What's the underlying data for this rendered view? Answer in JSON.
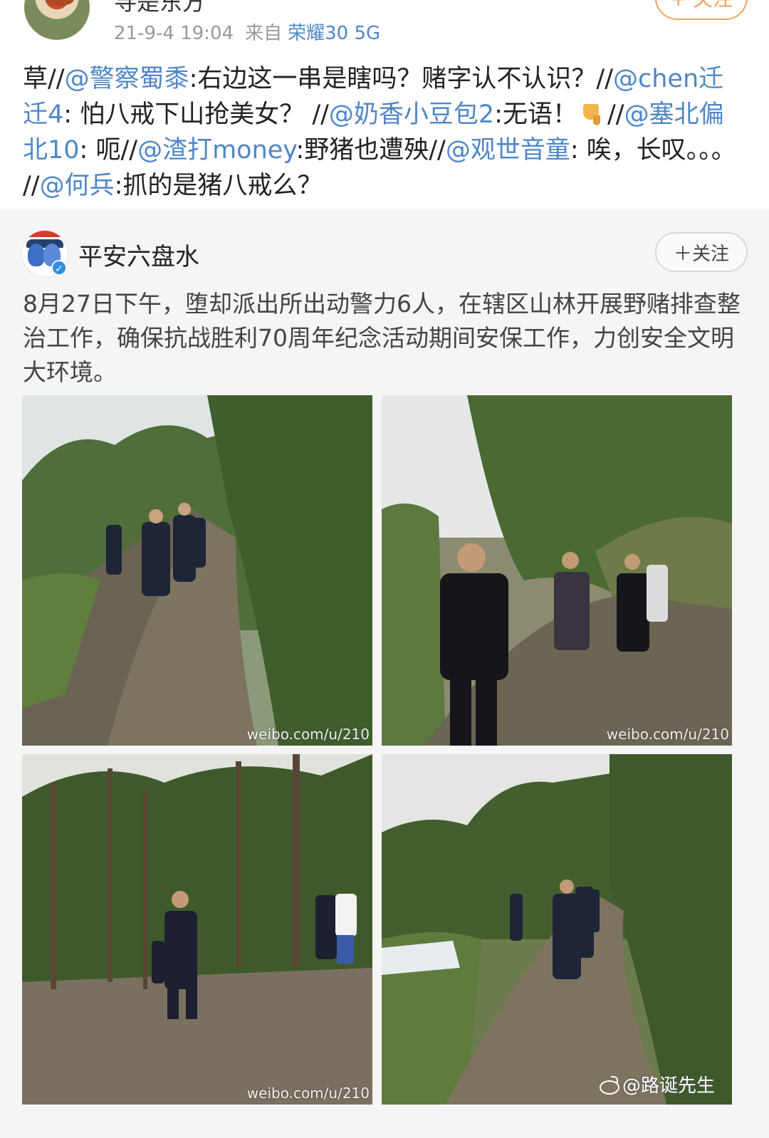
{
  "repost": {
    "username": "寻是东方",
    "time": "21-9-4 19:04",
    "source_prefix": "来自",
    "device": "荣耀30 5G",
    "follow_label": "+ 关注",
    "comment": [
      {
        "t": "text",
        "v": "草//"
      },
      {
        "t": "mention",
        "v": "@警察蜀黍"
      },
      {
        "t": "text",
        "v": ":右边这一串是瞎吗？赌字认不认识？//"
      },
      {
        "t": "mention",
        "v": "@chen迁迁4"
      },
      {
        "t": "text",
        "v": ": 怕八戒下山抢美女？ //"
      },
      {
        "t": "mention",
        "v": "@奶香小豆包2"
      },
      {
        "t": "text",
        "v": ":无语！"
      },
      {
        "t": "emoji",
        "v": "thumbs-down"
      },
      {
        "t": "text",
        "v": "//"
      },
      {
        "t": "mention",
        "v": "@塞北偏北10"
      },
      {
        "t": "text",
        "v": ": 呃//"
      },
      {
        "t": "mention",
        "v": "@渣打money"
      },
      {
        "t": "text",
        "v": ":野猪也遭殃//"
      },
      {
        "t": "mention",
        "v": "@观世音童"
      },
      {
        "t": "text",
        "v": ": 唉，长叹。。。 //"
      },
      {
        "t": "mention",
        "v": "@何兵"
      },
      {
        "t": "text",
        "v": ":抓的是猪八戒么？"
      }
    ]
  },
  "original": {
    "username": "平安六盘水",
    "follow_label": "＋关注",
    "text": "8月27日下午，堕却派出所出动警力6人，在辖区山林开展野赌排查整治工作，确保抗战胜利70周年纪念活动期间安保工作，力创安全文明大环境。",
    "photos": [
      {
        "watermark": "weibo.com/u/210"
      },
      {
        "watermark": "weibo.com/u/210"
      },
      {
        "watermark": "weibo.com/u/210"
      },
      {
        "watermark": ""
      }
    ],
    "credit": "@路诞先生"
  },
  "colors": {
    "link": "#4f86c7",
    "follow_orange": "#f2a25c",
    "card_bg": "#f5f5f5",
    "verified": "#2f8fe3"
  }
}
